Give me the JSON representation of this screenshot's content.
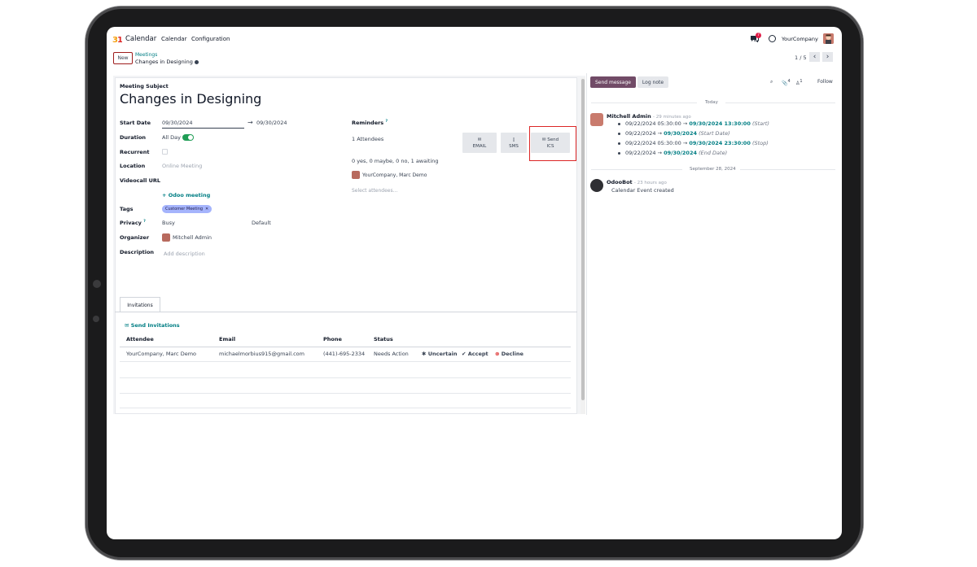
{
  "navbar": {
    "app_name": "Calendar",
    "menu": [
      "Calendar",
      "Configuration"
    ],
    "chat_count": "7",
    "company": "YourCompany"
  },
  "control": {
    "new_label": "New",
    "breadcrumb_parent": "Meetings",
    "breadcrumb_current": "Changes in Designing",
    "pager": "1 / 5"
  },
  "form": {
    "subject_label": "Meeting Subject",
    "subject": "Changes in Designing",
    "start_date_label": "Start Date",
    "start_date": "09/30/2024",
    "end_date": "09/30/2024",
    "duration_label": "Duration",
    "all_day": "All Day",
    "recurrent_label": "Recurrent",
    "location_label": "Location",
    "location_placeholder": "Online Meeting",
    "videocall_label": "Videocall URL",
    "odoo_meeting": "Odoo meeting",
    "tags_label": "Tags",
    "tag": "Customer Meeting",
    "privacy_label": "Privacy",
    "privacy_busy": "Busy",
    "privacy_default": "Default",
    "organizer_label": "Organizer",
    "organizer": "Mitchell Admin",
    "description_label": "Description",
    "description_placeholder": "Add description",
    "reminders_label": "Reminders",
    "attendees_count": "1 Attendees",
    "attendee_summary": "0 yes, 0 maybe, 0 no, 1 awaiting",
    "attendee_name": "YourCompany, Marc Demo",
    "select_attendees": "Select attendees...",
    "btn_email": "EMAIL",
    "btn_sms": "SMS",
    "btn_send": "Send",
    "btn_ics": "ICS"
  },
  "invitations": {
    "tab": "Invitations",
    "send_link": "Send Invitations",
    "headers": [
      "Attendee",
      "Email",
      "Phone",
      "Status"
    ],
    "row": {
      "attendee": "YourCompany, Marc Demo",
      "email": "michaelmorbius915@gmail.com",
      "phone": "(441)-695-2334",
      "status": "Needs Action",
      "uncertain": "Uncertain",
      "accept": "Accept",
      "decline": "Decline"
    }
  },
  "chatter": {
    "send_message": "Send message",
    "log_note": "Log note",
    "attachments_count": "4",
    "followers_count": "1",
    "follow": "Follow",
    "today": "Today",
    "msg1": {
      "author": "Mitchell Admin",
      "time": "- 29 minutes ago",
      "tracking": [
        {
          "old": "09/22/2024 05:30:00",
          "new": "09/30/2024 13:30:00",
          "field": "(Start)"
        },
        {
          "old": "09/22/2024",
          "new": "09/30/2024",
          "field": "(Start Date)"
        },
        {
          "old": "09/22/2024 05:30:00",
          "new": "09/30/2024 23:30:00",
          "field": "(Stop)"
        },
        {
          "old": "09/22/2024",
          "new": "09/30/2024",
          "field": "(End Date)"
        }
      ]
    },
    "date_sep": "September 28, 2024",
    "msg2": {
      "author": "OdooBot",
      "time": "- 23 hours ago",
      "body": "Calendar Event created"
    }
  }
}
